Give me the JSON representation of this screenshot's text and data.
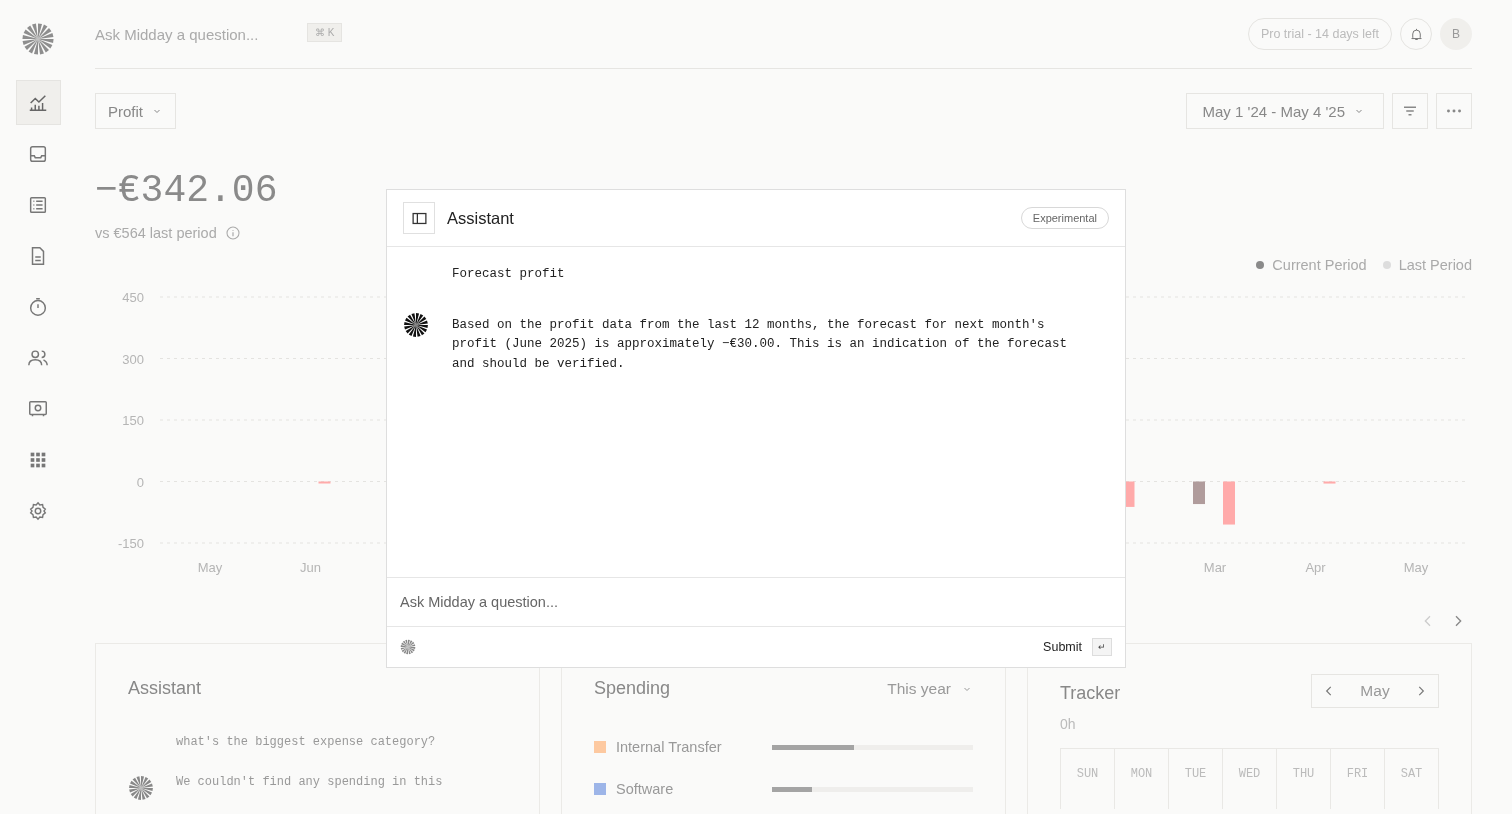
{
  "sidebar": {
    "items": [
      {
        "kind": "chart",
        "selected": true
      },
      {
        "kind": "inbox",
        "selected": false
      },
      {
        "kind": "list",
        "selected": false
      },
      {
        "kind": "document",
        "selected": false
      },
      {
        "kind": "timer",
        "selected": false
      },
      {
        "kind": "people",
        "selected": false
      },
      {
        "kind": "vault",
        "selected": false
      },
      {
        "kind": "apps",
        "selected": false
      },
      {
        "kind": "settings",
        "selected": false
      }
    ]
  },
  "topbar": {
    "search_placeholder": "Ask Midday a question...",
    "shortcut": "⌘ K",
    "trial_badge": "Pro trial - 14 days left",
    "avatar": "B"
  },
  "toolbar": {
    "metric": "Profit",
    "date_range": "May 1 '24 - May 4 '25"
  },
  "summary": {
    "amount": "−€342.06",
    "comparison": "vs €564 last period"
  },
  "chart": {
    "legend_dots": [
      {
        "color": "#8a8a8a"
      },
      {
        "color": "#dddddd"
      }
    ],
    "chart_data": {
      "type": "bar",
      "grid": true,
      "categories": [
        "May",
        "Jun",
        null,
        null,
        null,
        null,
        null,
        null,
        null,
        null,
        "Mar",
        "Apr",
        "May"
      ],
      "yticks": [
        450,
        300,
        150,
        0,
        -150
      ],
      "ylim": [
        -150,
        450
      ],
      "series": [
        {
          "name": "Current Period",
          "color": "#ffaaaa",
          "values": [
            null,
            -3,
            null,
            null,
            null,
            null,
            null,
            null,
            null,
            -62,
            -105,
            -5,
            null
          ]
        },
        {
          "name": "Last Period",
          "color": "#b09c9c",
          "values": [
            null,
            null,
            null,
            null,
            null,
            null,
            null,
            null,
            null,
            null,
            -55,
            null,
            null
          ]
        }
      ]
    }
  },
  "assistant_modal": {
    "title": "Assistant",
    "badge": "Experimental",
    "messages": [
      {
        "kind": "user",
        "text": "Forecast profit"
      },
      {
        "kind": "assistant",
        "text": "Based on the profit data from the last 12 months, the forecast for next month's profit (June 2025) is approximately −€30.00. This is an indication of the forecast and should be verified."
      }
    ],
    "input_placeholder": "Ask Midday a question...",
    "submit": "Submit",
    "submit_key": "↵"
  },
  "cards": {
    "assistant": {
      "title": "Assistant",
      "messages": [
        {
          "kind": "user",
          "text": "what's the biggest expense category?"
        },
        {
          "kind": "assistant",
          "text": "We couldn't find any spending in this"
        }
      ]
    },
    "spending": {
      "title": "Spending",
      "period": "This year",
      "items": [
        {
          "label": "Internal Transfer",
          "color": "#fdc9a0",
          "level": 0.41
        },
        {
          "label": "Software",
          "color": "#9db5e8",
          "level": 0.2
        }
      ]
    },
    "tracker": {
      "title": "Tracker",
      "total": "0h",
      "month": "May",
      "weekdays": [
        "SUN",
        "MON",
        "TUE",
        "WED",
        "THU",
        "FRI",
        "SAT"
      ]
    }
  }
}
